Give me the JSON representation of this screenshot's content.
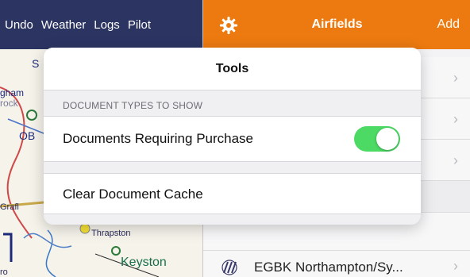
{
  "left_nav": {
    "undo_label": "Undo",
    "weather_label": "Weather",
    "logs_label": "Logs",
    "pilot_label": "Pilot"
  },
  "map": {
    "labels": {
      "gham": "gham",
      "rock": "rock",
      "ob": "OB",
      "s": "S",
      "grafl": "Grafl",
      "thrapston": "Thrapston",
      "keyston": "Keyston",
      "t": "T",
      "ro": "ro"
    }
  },
  "right_header": {
    "title": "Airfields",
    "add_label": "Add",
    "gear_icon": "gear-icon"
  },
  "airfield_list": {
    "visible_item_label": "EGBK Northampton/Sy..."
  },
  "popover": {
    "title": "Tools",
    "section_header": "DOCUMENT TYPES TO SHOW",
    "purchase_row_label": "Documents Requiring Purchase",
    "purchase_toggle_on": true,
    "clear_cache_label": "Clear Document Cache"
  },
  "colors": {
    "left_bar": "#2c3562",
    "right_bar": "#ec7a10",
    "toggle_on": "#4cd964"
  }
}
